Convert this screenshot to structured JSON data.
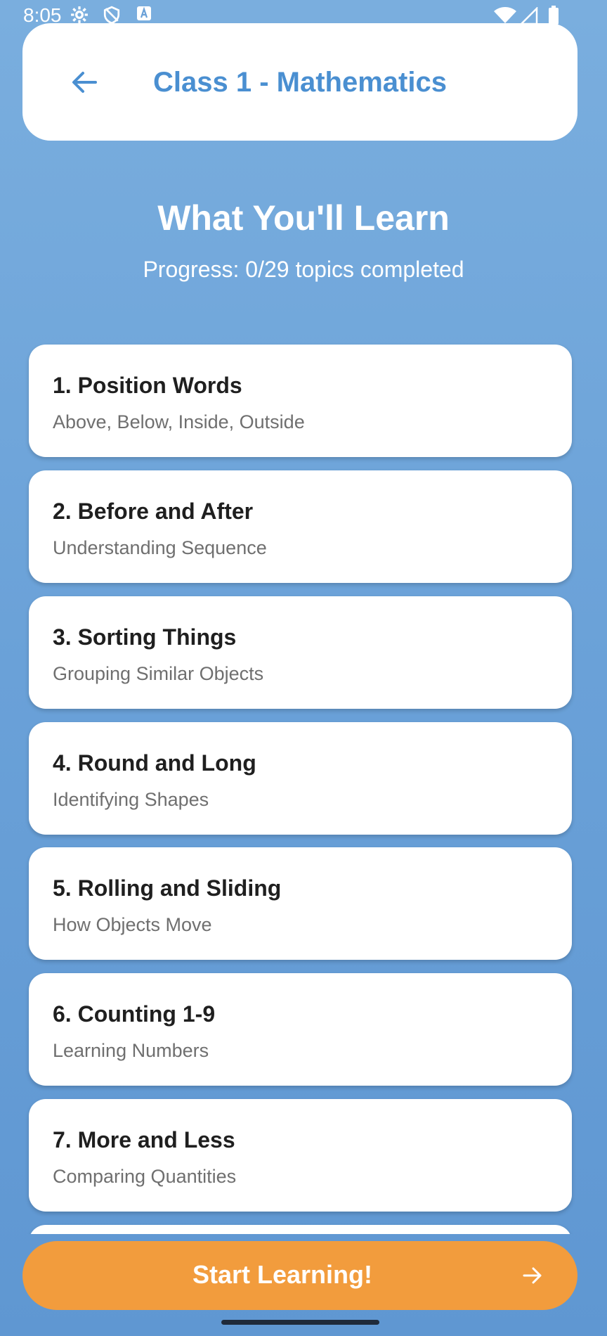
{
  "status_bar": {
    "time": "8:05"
  },
  "header": {
    "title": "Class 1 - Mathematics"
  },
  "intro": {
    "title": "What You'll Learn",
    "progress": "Progress: 0/29 topics completed"
  },
  "topics": [
    {
      "title": "1. Position Words",
      "subtitle": "Above, Below, Inside, Outside"
    },
    {
      "title": "2. Before and After",
      "subtitle": "Understanding Sequence"
    },
    {
      "title": "3. Sorting Things",
      "subtitle": "Grouping Similar Objects"
    },
    {
      "title": "4. Round and Long",
      "subtitle": "Identifying Shapes"
    },
    {
      "title": "5. Rolling and Sliding",
      "subtitle": "How Objects Move"
    },
    {
      "title": "6. Counting 1-9",
      "subtitle": "Learning Numbers"
    },
    {
      "title": "7. More and Less",
      "subtitle": "Comparing Quantities"
    }
  ],
  "cta": {
    "label": "Start Learning!"
  },
  "colors": {
    "accent": "#4a8fd1",
    "cta": "#f29c3d",
    "background": "#6aa1d8"
  },
  "icons": {
    "back": "arrow-left-icon",
    "cta": "arrow-right-icon"
  }
}
